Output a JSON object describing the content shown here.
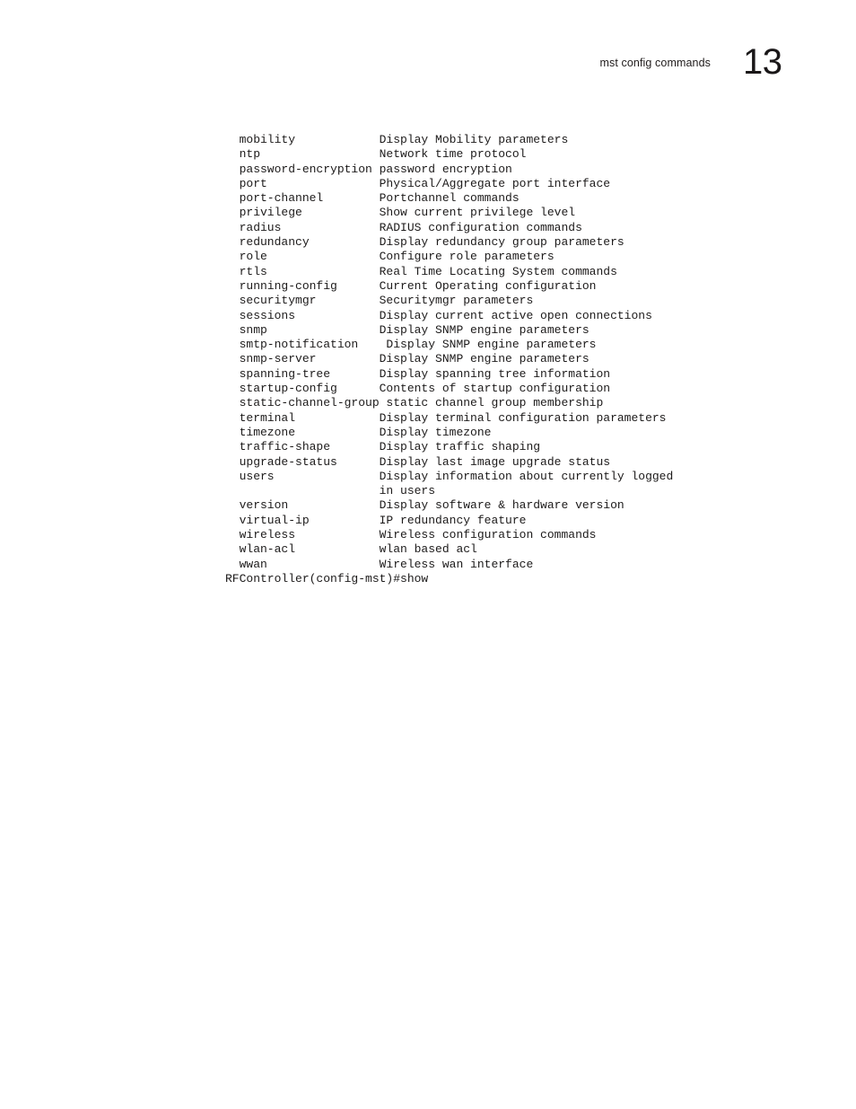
{
  "header": {
    "title": "mst config commands",
    "page_number": "13"
  },
  "cli": {
    "prompt_line": "RFController(config-mst)#show",
    "name_indent": 2,
    "description_column": 22,
    "commands": [
      {
        "name": "mobility",
        "description": "Display Mobility parameters"
      },
      {
        "name": "ntp",
        "description": "Network time protocol"
      },
      {
        "name": "password-encryption",
        "description": "password encryption"
      },
      {
        "name": "port",
        "description": "Physical/Aggregate port interface"
      },
      {
        "name": "port-channel",
        "description": "Portchannel commands"
      },
      {
        "name": "privilege",
        "description": "Show current privilege level"
      },
      {
        "name": "radius",
        "description": "RADIUS configuration commands"
      },
      {
        "name": "redundancy",
        "description": "Display redundancy group parameters"
      },
      {
        "name": "role",
        "description": "Configure role parameters"
      },
      {
        "name": "rtls",
        "description": "Real Time Locating System commands"
      },
      {
        "name": "running-config",
        "description": "Current Operating configuration"
      },
      {
        "name": "securitymgr",
        "description": "Securitymgr parameters"
      },
      {
        "name": "sessions",
        "description": "Display current active open connections"
      },
      {
        "name": "snmp",
        "description": "Display SNMP engine parameters"
      },
      {
        "name": "smtp-notification",
        "description": " Display SNMP engine parameters"
      },
      {
        "name": "snmp-server",
        "description": "Display SNMP engine parameters"
      },
      {
        "name": "spanning-tree",
        "description": "Display spanning tree information"
      },
      {
        "name": "startup-config",
        "description": "Contents of startup configuration"
      },
      {
        "name": "static-channel-group",
        "description": "static channel group membership"
      },
      {
        "name": "terminal",
        "description": "Display terminal configuration parameters"
      },
      {
        "name": "timezone",
        "description": "Display timezone"
      },
      {
        "name": "traffic-shape",
        "description": "Display traffic shaping"
      },
      {
        "name": "upgrade-status",
        "description": "Display last image upgrade status"
      },
      {
        "name": "users",
        "description": "Display information about currently logged",
        "continuation": "in users"
      },
      {
        "name": "version",
        "description": "Display software & hardware version"
      },
      {
        "name": "virtual-ip",
        "description": "IP redundancy feature"
      },
      {
        "name": "wireless",
        "description": "Wireless configuration commands"
      },
      {
        "name": "wlan-acl",
        "description": "wlan based acl"
      },
      {
        "name": "wwan",
        "description": "Wireless wan interface"
      }
    ]
  }
}
